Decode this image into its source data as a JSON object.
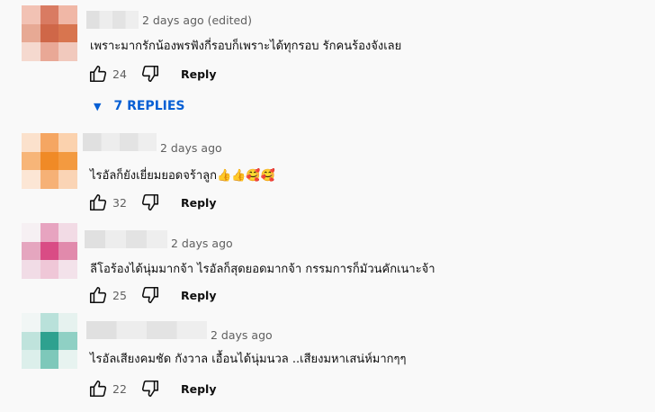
{
  "comments": [
    {
      "time": "2 days ago (edited)",
      "text": "เพราะมากรักน้องพรฟังกี่รอบก็เพราะได้ทุกรอบ รักคนร้องจังเลย",
      "likes": "24",
      "reply_label": "Reply",
      "replies_label": "7 REPLIES",
      "avatar_colors": [
        "#f2c2b4",
        "#d97b62",
        "#f0b7a6",
        "#e7a994",
        "#cf6748",
        "#d8754f",
        "#f5d9cf",
        "#e9a896",
        "#f1c9bd"
      ]
    },
    {
      "time": "2 days ago",
      "text": "ไรอัลก็ยังเยี่ยมยอดจร้าลูก👍👍🥰🥰",
      "likes": "32",
      "reply_label": "Reply",
      "avatar_colors": [
        "#fbe1cc",
        "#f5a662",
        "#fbd2ae",
        "#f7b578",
        "#f08a26",
        "#f39a40",
        "#fce6d5",
        "#f6b176",
        "#fad4b5"
      ]
    },
    {
      "time": "2 days ago",
      "text": "ลีโอร้องได้นุ่มมากจ้า  ไรอัลก็สุดยอดมากจ้า  กรรมการก็มัวนคักเนาะจ้า",
      "likes": "25",
      "reply_label": "Reply",
      "avatar_colors": [
        "#f6f0f3",
        "#e7a4c0",
        "#f2dbe5",
        "#e5a6bf",
        "#d94c85",
        "#e18aac",
        "#f1dce6",
        "#efc7d7",
        "#f3e2ea"
      ]
    },
    {
      "time": "2 days ago",
      "text": "ไรอัลเสียงคมชัด กังวาล เอื้อนได้นุ่มนวล  ..เสียงมหาเสน่ห์มากๆๆ",
      "likes": "22",
      "reply_label": "Reply",
      "avatar_colors": [
        "#f1f6f5",
        "#b9e1da",
        "#e6f2ef",
        "#bfe3dc",
        "#2ea18f",
        "#8fd0c4",
        "#dcefeb",
        "#7ec8ba",
        "#e7f3f0"
      ]
    }
  ]
}
